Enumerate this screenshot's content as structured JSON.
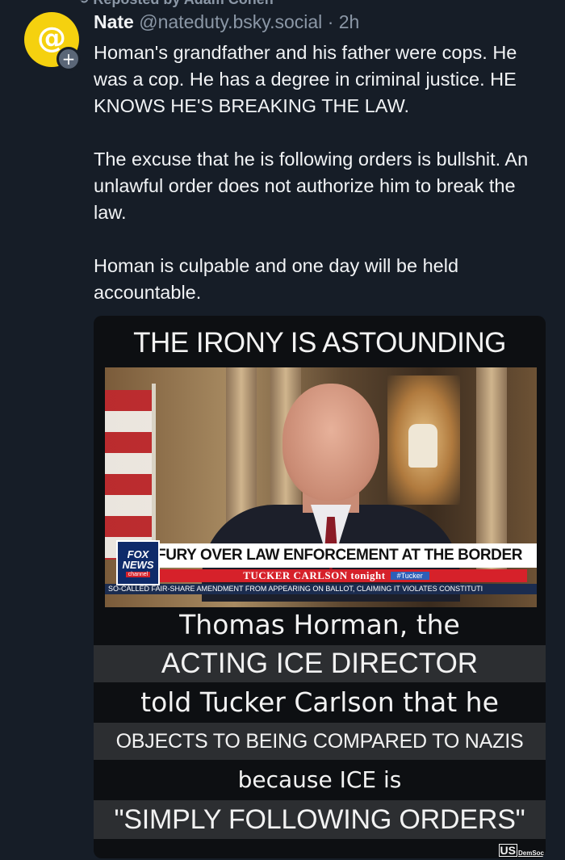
{
  "repost": {
    "label": "Reposted by Adam Cohen",
    "icon": "repost-icon"
  },
  "post": {
    "avatar_icon": "at-icon",
    "avatar_color": "#f5d10f",
    "follow_badge_icon": "plus-icon",
    "author": "Nate",
    "handle": "@nateduty.bsky.social",
    "separator": "·",
    "time": "2h",
    "paragraphs": [
      "Homan's grandfather and his father were cops. He was a cop. He has a degree in criminal justice. HE KNOWS HE'S BREAKING THE LAW.",
      "The excuse that he is following orders is bullshit. An unlawful order does not authorize him to break the law.",
      "Homan is culpable and one day will be held accountable."
    ]
  },
  "meme": {
    "title": "THE IRONY IS ASTOUNDING",
    "tv": {
      "logo_line1": "FOX",
      "logo_line2": "NEWS",
      "logo_line3": "channel",
      "headline": "FURY OVER LAW ENFORCEMENT AT THE BORDER",
      "show": "TUCKER CARLSON tonight",
      "hashtag": "#Tucker",
      "ticker": "SO-CALLED FAIR-SHARE AMENDMENT FROM APPEARING ON BALLOT, CLAIMING IT VIOLATES CONSTITUTI"
    },
    "captions": [
      "Thomas Horman, the",
      "ACTING ICE DIRECTOR",
      "told Tucker Carlson that he",
      "OBJECTS TO BEING COMPARED TO NAZIS",
      "because ICE is",
      "\"SIMPLY FOLLOWING ORDERS\""
    ],
    "watermark_a": "US",
    "watermark_b": "DemSoc"
  },
  "colors": {
    "background": "#161d27",
    "text": "#f1f3f5",
    "muted": "#8b97a6",
    "fox_red": "#d6212a",
    "fox_blue": "#0f2b6a"
  }
}
